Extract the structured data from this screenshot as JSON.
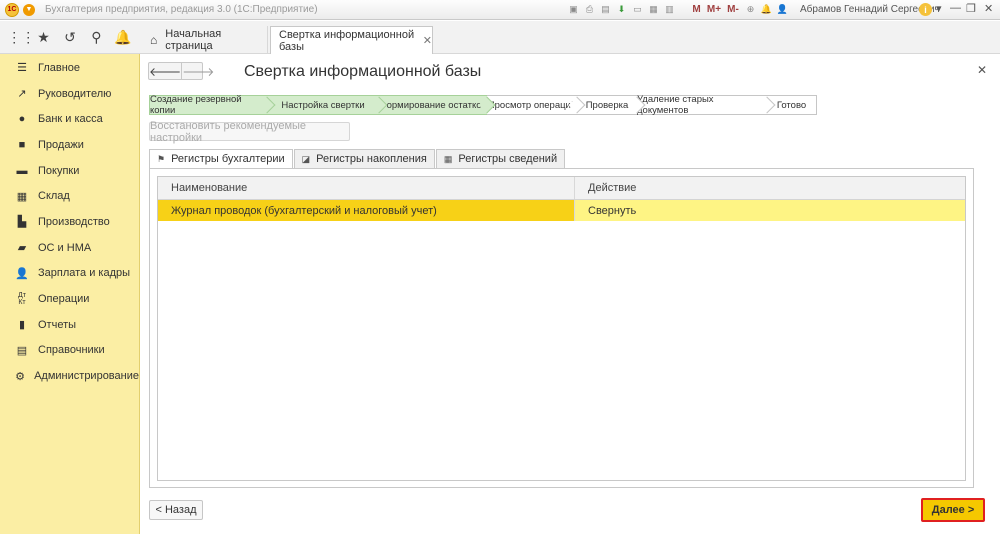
{
  "app": {
    "title": "Бухгалтерия предприятия, редакция 3.0  (1С:Предприятие)",
    "logo_text": "1С",
    "user": "Абрамов Геннадий Сергеевич",
    "m_label": "M",
    "mplus_label": "M+",
    "mminus_label": "M-"
  },
  "tabs": [
    {
      "label": "Начальная страница"
    },
    {
      "label": "Свертка информационной базы"
    }
  ],
  "sidebar": {
    "items": [
      {
        "label": "Главное",
        "icon": "menu-icon"
      },
      {
        "label": "Руководителю",
        "icon": "trend-icon"
      },
      {
        "label": "Банк и касса",
        "icon": "coin-icon"
      },
      {
        "label": "Продажи",
        "icon": "bag-icon"
      },
      {
        "label": "Покупки",
        "icon": "cart-icon"
      },
      {
        "label": "Склад",
        "icon": "warehouse-icon"
      },
      {
        "label": "Производство",
        "icon": "factory-icon"
      },
      {
        "label": "ОС и НМА",
        "icon": "truck-icon"
      },
      {
        "label": "Зарплата и кадры",
        "icon": "person-icon"
      },
      {
        "label": "Операции",
        "icon": "dt-kt-icon"
      },
      {
        "label": "Отчеты",
        "icon": "bar-chart-icon"
      },
      {
        "label": "Справочники",
        "icon": "books-icon"
      },
      {
        "label": "Администрирование",
        "icon": "gear-icon"
      }
    ]
  },
  "main": {
    "title": "Свертка информационной базы",
    "steps": [
      {
        "label": "Создание резервной копии",
        "done": true
      },
      {
        "label": "Настройка свертки",
        "done": true
      },
      {
        "label": "Формирование остатков",
        "done": true
      },
      {
        "label": "Просмотр операций",
        "done": false
      },
      {
        "label": "Проверка",
        "done": false
      },
      {
        "label": "Удаление старых документов",
        "done": false
      },
      {
        "label": "Готово",
        "done": false
      }
    ],
    "restore_button": "Восстановить рекомендуемые настройки",
    "form_tabs": [
      {
        "label": "Регистры бухгалтерии",
        "active": true
      },
      {
        "label": "Регистры накопления",
        "active": false
      },
      {
        "label": "Регистры сведений",
        "active": false
      }
    ],
    "table": {
      "columns": [
        "Наименование",
        "Действие"
      ],
      "rows": [
        [
          "Журнал проводок (бухгалтерский и налоговый учет)",
          "Свернуть"
        ]
      ]
    },
    "back_button": "< Назад",
    "next_button": "Далее >"
  },
  "colors": {
    "sidebar_bg": "#fbeea4",
    "row_highlight": "#fef484",
    "step_done": "#d4eccc",
    "next_button": "#f5c800",
    "next_border": "#e02020"
  }
}
